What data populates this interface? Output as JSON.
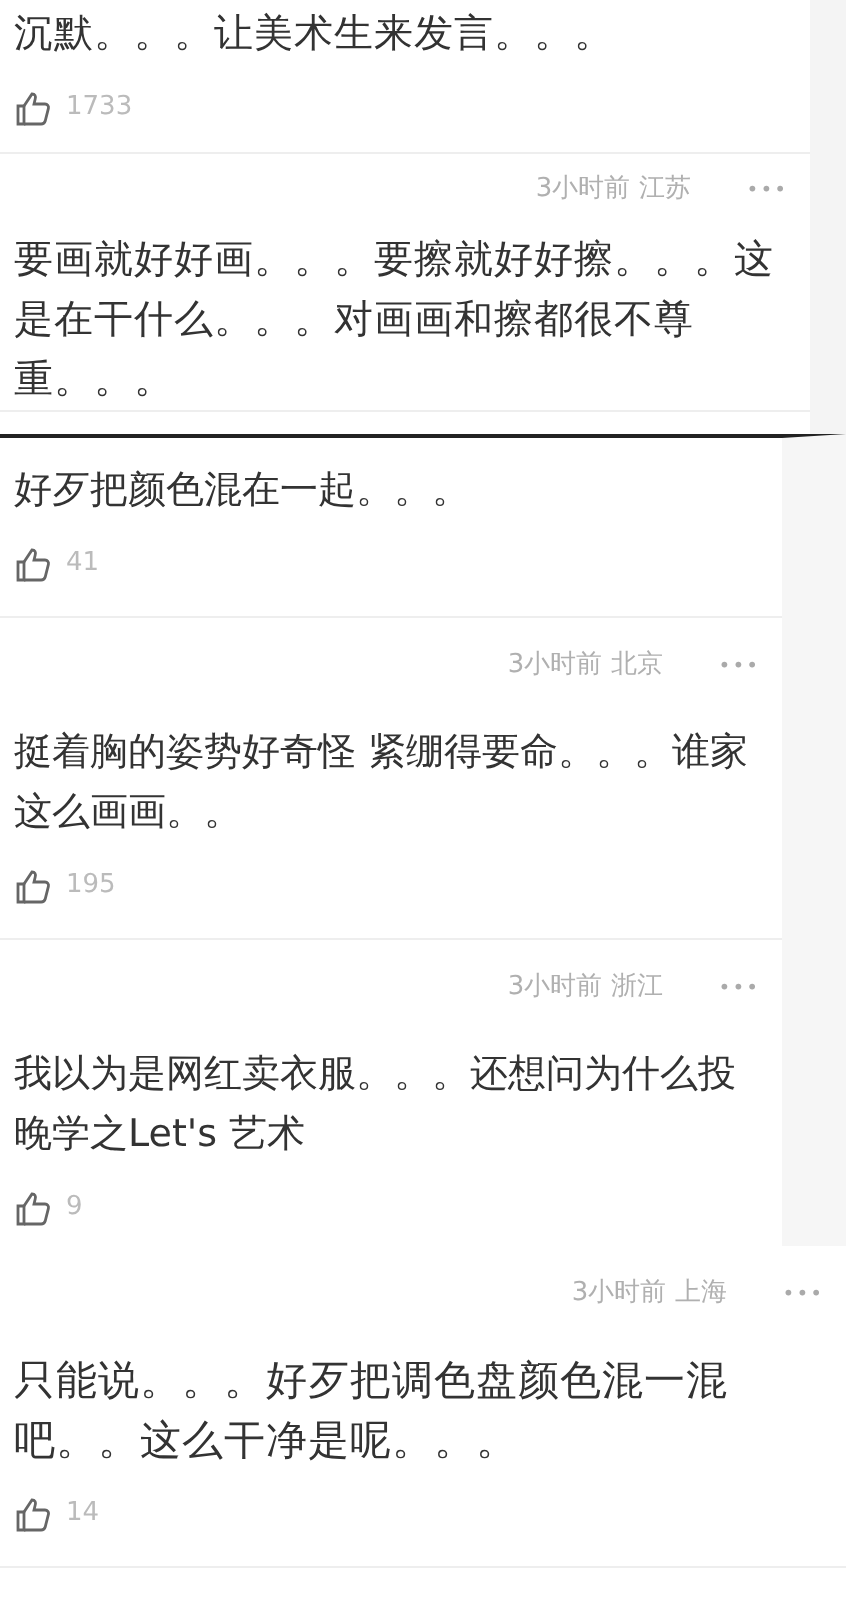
{
  "sections": [
    {
      "comments": [
        {
          "text": "沉默。。。让美术生来发言。。。",
          "likes": "1733"
        },
        {
          "meta": "3小时前 江苏",
          "more": "•••",
          "text": "要画就好好画。。。要擦就好好擦。。。这是在干什么。。。对画画和擦都很不尊重。。。"
        }
      ]
    },
    {
      "comments": [
        {
          "text": "好歹把颜色混在一起。。。",
          "likes": "41"
        },
        {
          "meta": "3小时前 北京",
          "more": "•••",
          "text": "挺着胸的姿势好奇怪 紧绷得要命。。。谁家这么画画。。",
          "likes": "195"
        },
        {
          "meta": "3小时前 浙江",
          "more": "•••",
          "text": "我以为是网红卖衣服。。。还想问为什么投晚学之Let's 艺术",
          "likes": "9"
        }
      ]
    },
    {
      "comments": [
        {
          "meta": "3小时前 上海",
          "more": "•••",
          "text": "只能说。。。好歹把调色盘颜色混一混吧。。这么干净是呢。。。",
          "likes": "14"
        }
      ]
    }
  ]
}
